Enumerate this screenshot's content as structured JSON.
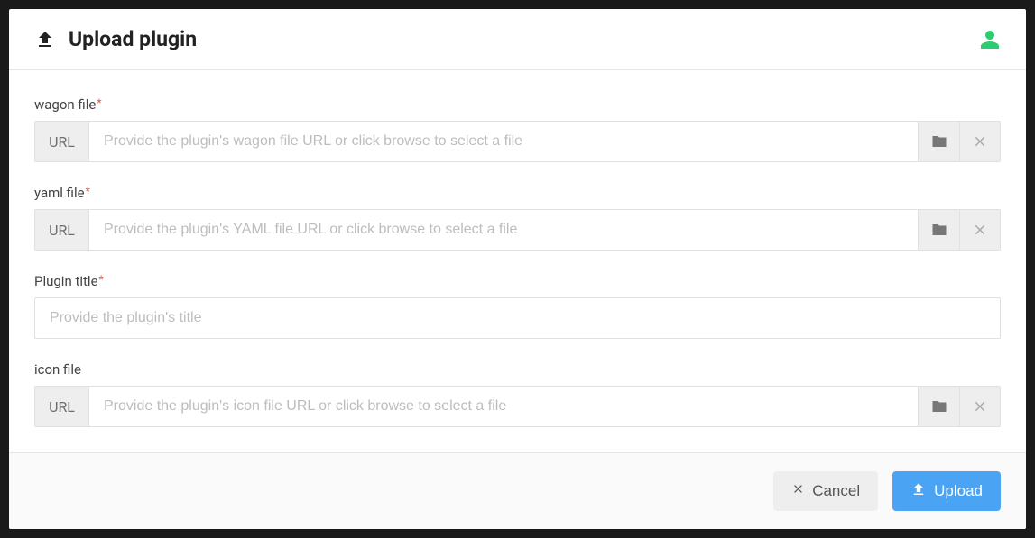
{
  "header": {
    "title": "Upload plugin"
  },
  "fields": {
    "wagon": {
      "label": "wagon file",
      "required_mark": "*",
      "prefix": "URL",
      "placeholder": "Provide the plugin's wagon file URL or click browse to select a file"
    },
    "yaml": {
      "label": "yaml file",
      "required_mark": "*",
      "prefix": "URL",
      "placeholder": "Provide the plugin's YAML file URL or click browse to select a file"
    },
    "title": {
      "label": "Plugin title",
      "required_mark": "*",
      "placeholder": "Provide the plugin's title"
    },
    "icon": {
      "label": "icon file",
      "prefix": "URL",
      "placeholder": "Provide the plugin's icon file URL or click browse to select a file"
    }
  },
  "footer": {
    "cancel_label": "Cancel",
    "upload_label": "Upload"
  }
}
